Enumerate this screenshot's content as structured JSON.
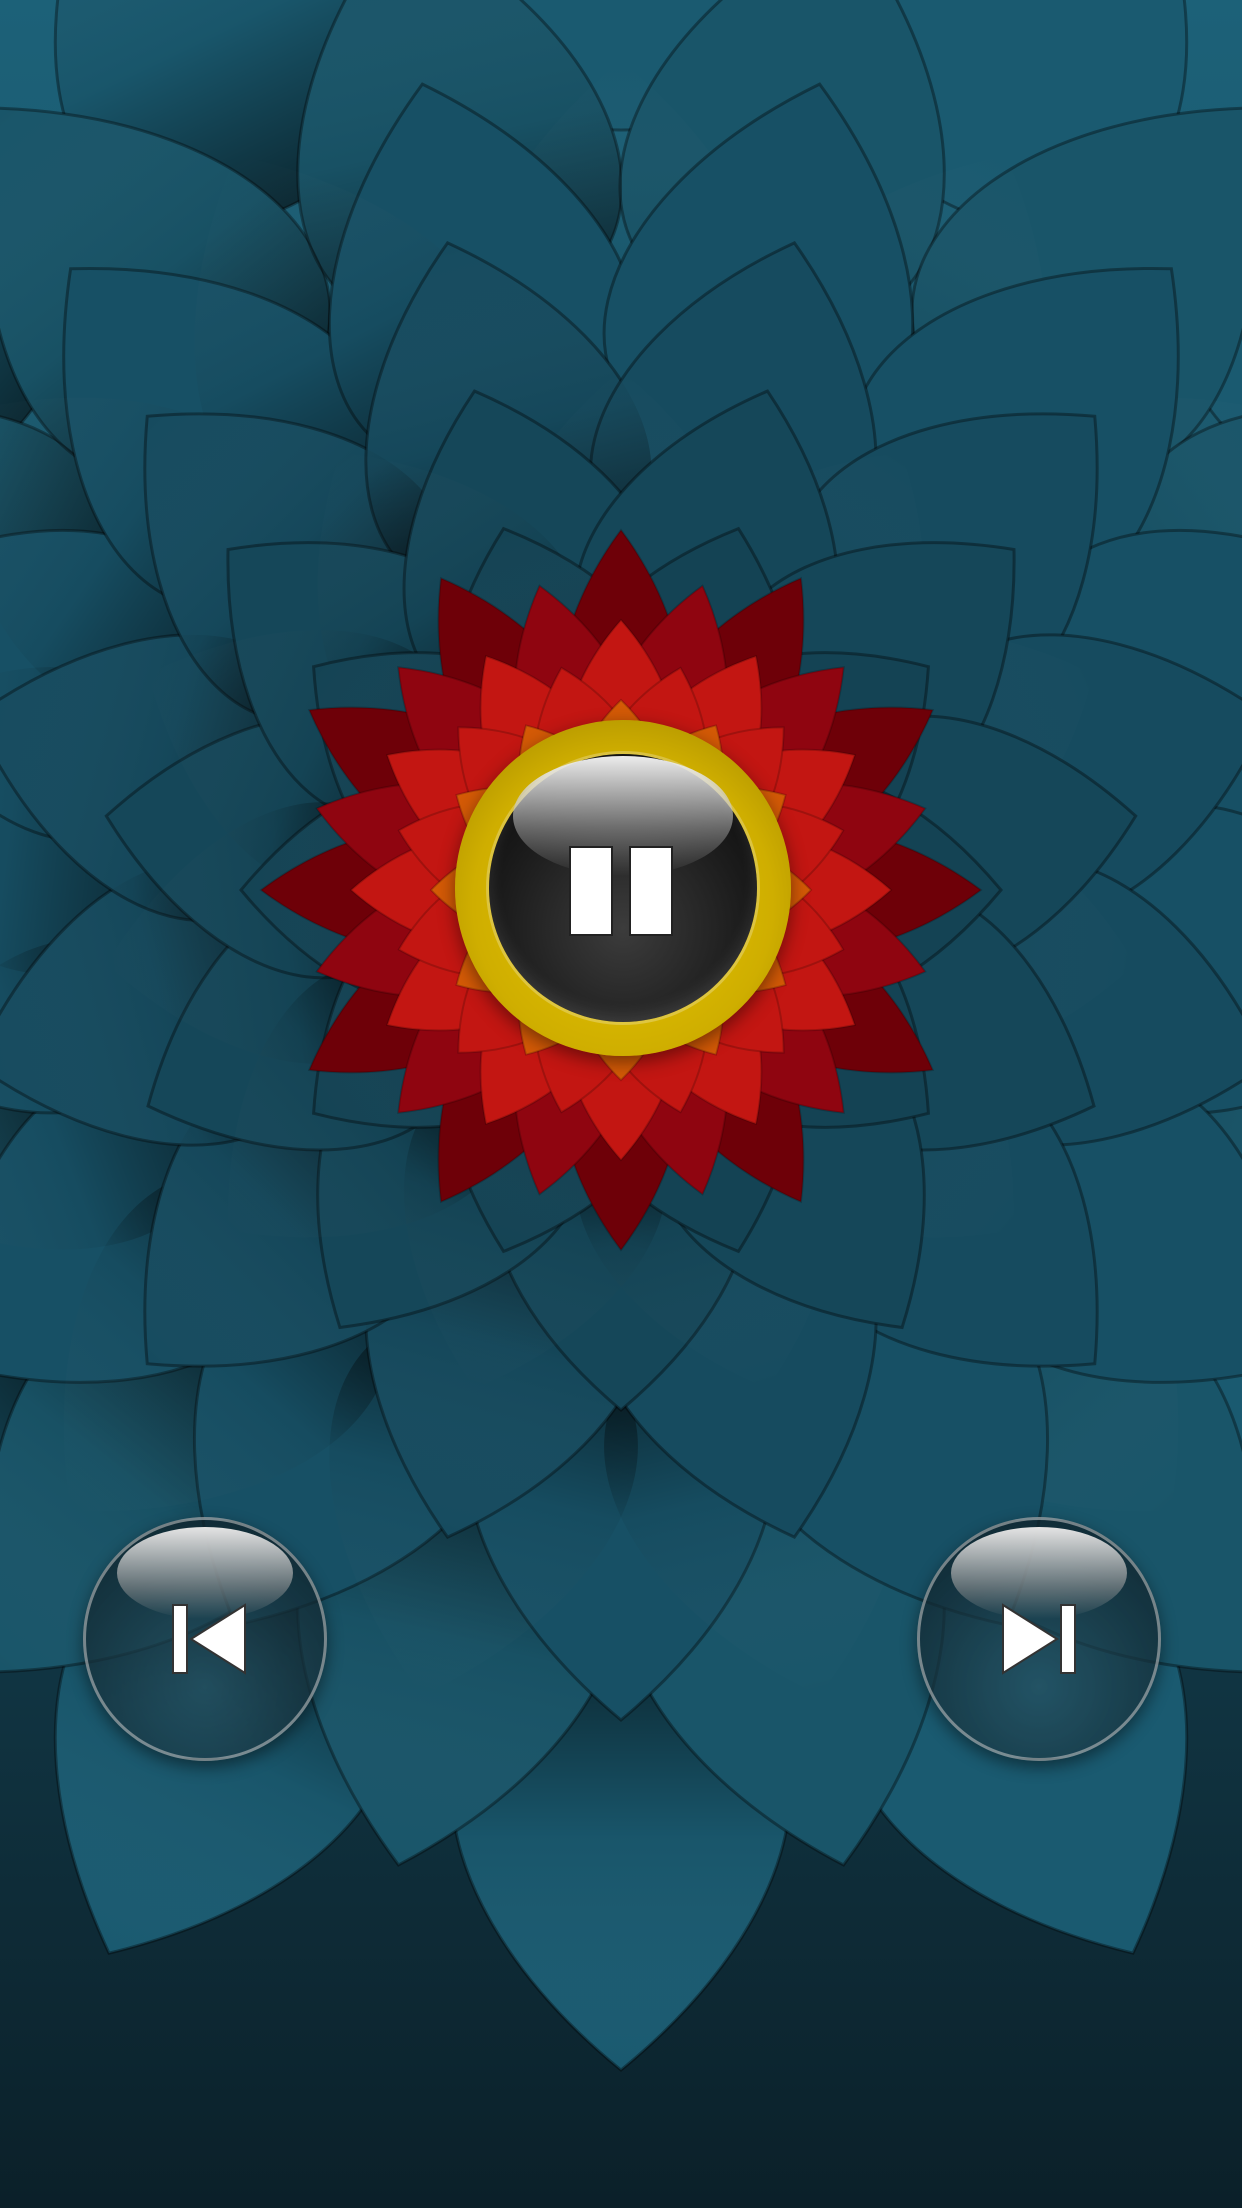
{
  "theme": {
    "background_top": "#1a5d74",
    "background_bottom": "#0a1f28",
    "flower_colors": [
      "#6e0008",
      "#8f0510",
      "#c31612",
      "#d45a06",
      "#e39b08",
      "#e4c300"
    ],
    "button_ring_color": "#d8b400"
  },
  "player": {
    "state": "playing",
    "play_pause_icon": "pause-icon",
    "previous_icon": "skip-previous-icon",
    "next_icon": "skip-next-icon"
  }
}
